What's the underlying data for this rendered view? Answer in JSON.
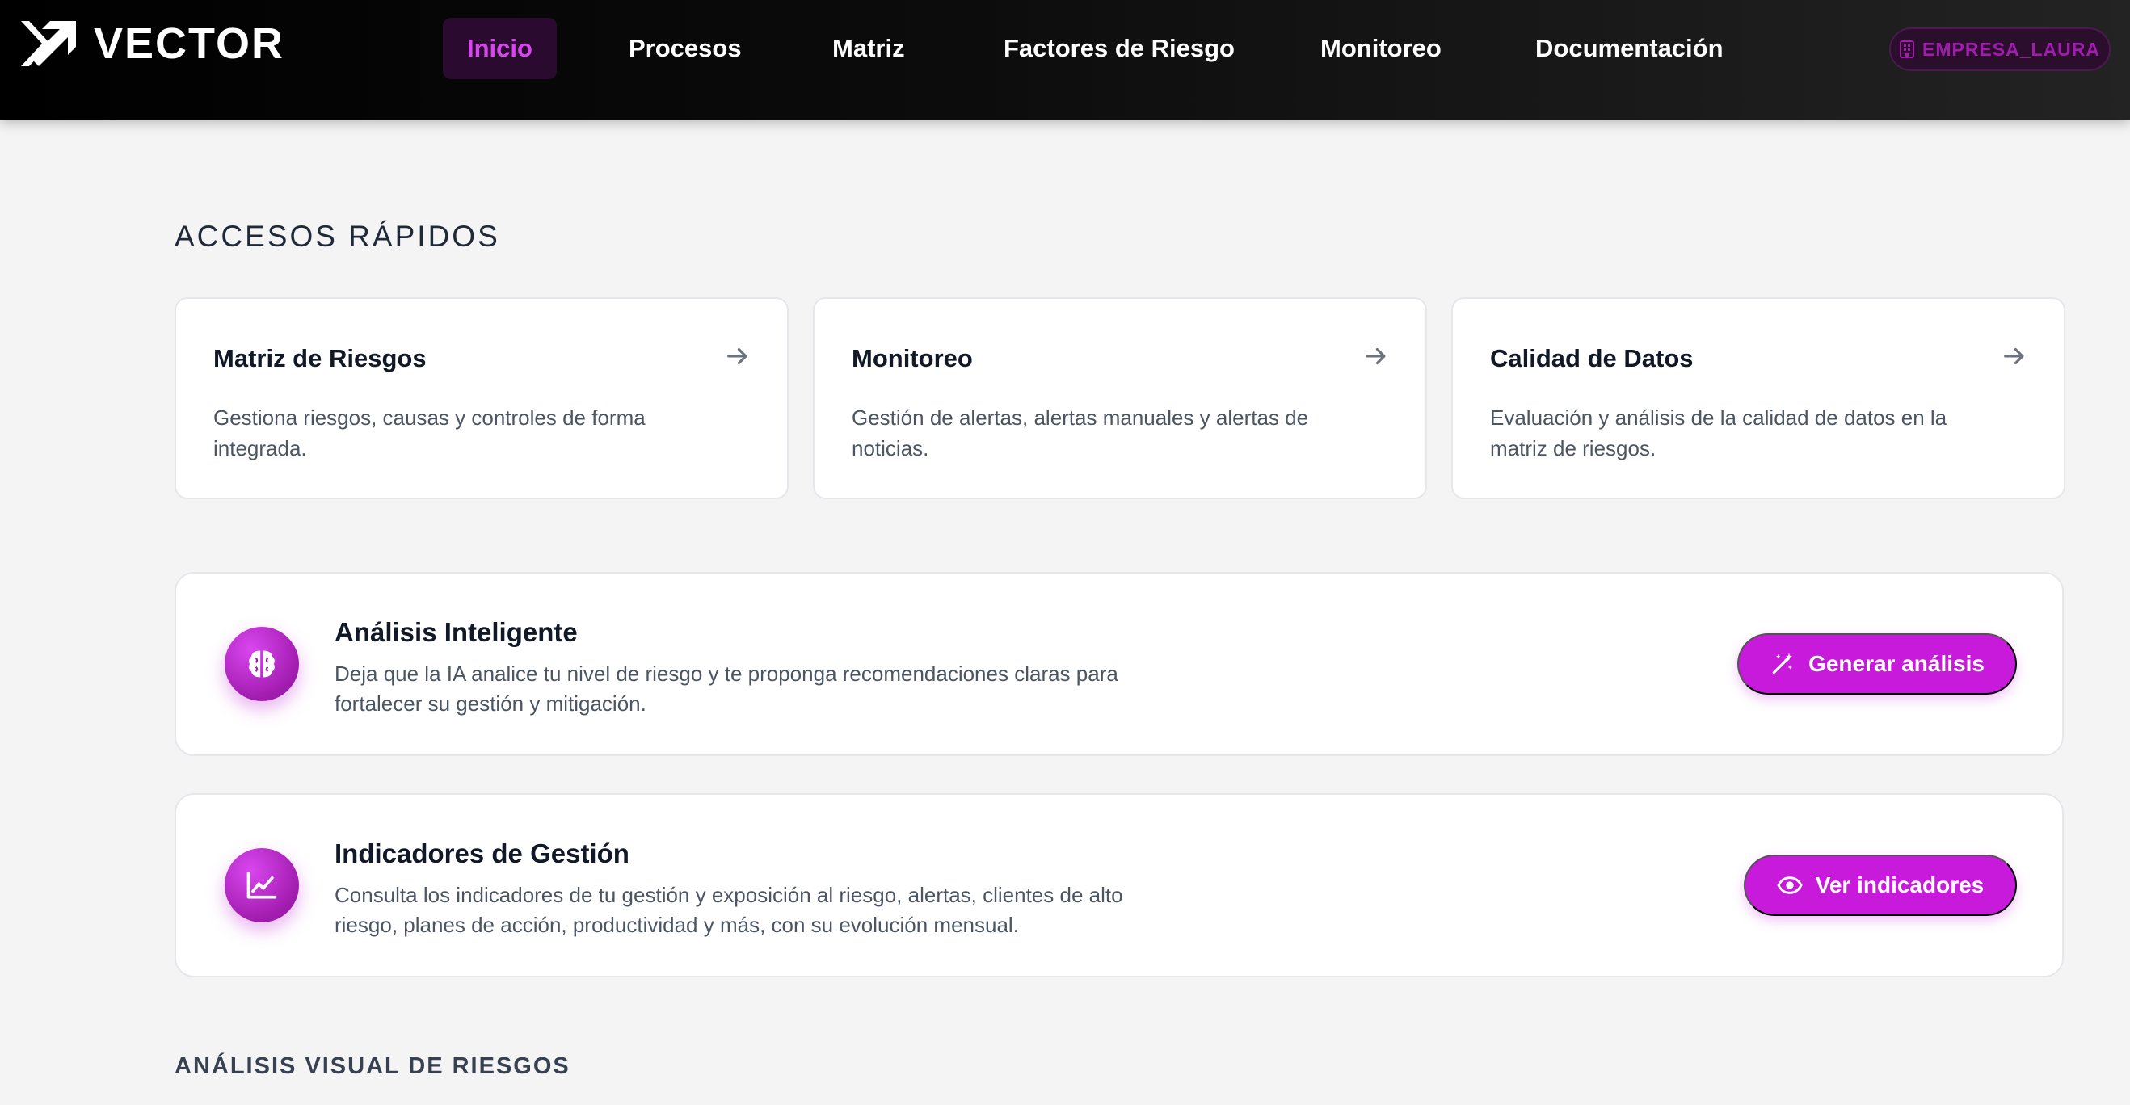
{
  "app": {
    "name": "VECTOR"
  },
  "nav": {
    "items": [
      {
        "label": "Inicio",
        "active": true
      },
      {
        "label": "Procesos"
      },
      {
        "label": "Matriz"
      },
      {
        "label": "Factores de Riesgo"
      },
      {
        "label": "Monitoreo"
      },
      {
        "label": "Documentación"
      }
    ],
    "company": "EMPRESA_LAURA"
  },
  "quick_access": {
    "title": "ACCESOS RÁPIDOS",
    "cards": [
      {
        "title": "Matriz de Riesgos",
        "description": "Gestiona riesgos, causas y controles de forma integrada.",
        "icon": "arrow-right-icon"
      },
      {
        "title": "Monitoreo",
        "description": "Gestión de alertas, alertas manuales y alertas de noticias.",
        "icon": "arrow-right-icon"
      },
      {
        "title": "Calidad de Datos",
        "description": "Evaluación y análisis de la calidad de datos en la matriz de riesgos.",
        "icon": "arrow-right-icon"
      }
    ]
  },
  "features": [
    {
      "title": "Análisis Inteligente",
      "description": "Deja que la IA analice tu nivel de riesgo y te proponga recomendaciones claras para fortalecer su gestión y mitigación.",
      "icon": "brain-icon",
      "button": "Generar análisis",
      "button_icon": "magic-wand-icon"
    },
    {
      "title": "Indicadores de Gestión",
      "description": "Consulta los indicadores de tu gestión y exposición al riesgo, alertas, clientes de alto riesgo, planes de acción, productividad y más, con su evolución mensual.",
      "icon": "line-chart-icon",
      "button": "Ver indicadores",
      "button_icon": "eye-icon"
    }
  ],
  "visual_analysis": {
    "title": "ANÁLISIS VISUAL DE RIESGOS"
  },
  "colors": {
    "accent": "#c81adb",
    "accent_dark": "#a21caf",
    "nav_bg": "#000000",
    "page_bg": "#f4f4f5"
  }
}
